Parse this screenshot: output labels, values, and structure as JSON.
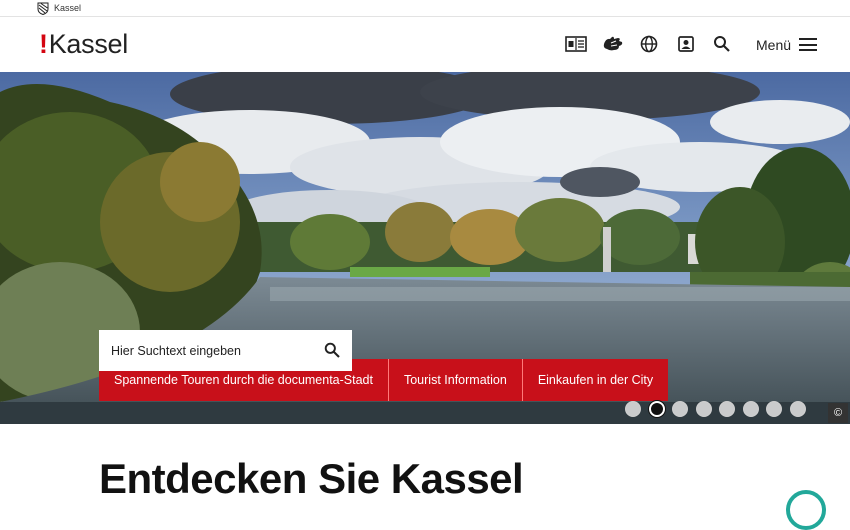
{
  "topbar": {
    "label": "Kassel"
  },
  "header": {
    "logo_text": "Kassel",
    "logo_mark": "!",
    "icons": [
      "easy-language-icon",
      "sign-language-icon",
      "globe-icon",
      "contact-icon",
      "search-icon"
    ],
    "menu_label": "Menü"
  },
  "hero": {
    "pills": [
      {
        "label": "Spannende Touren durch die documenta-Stadt"
      },
      {
        "label": "Tourist Information"
      },
      {
        "label": "Einkaufen in der City"
      }
    ],
    "search": {
      "placeholder": "Hier Suchtext eingeben"
    },
    "carousel": {
      "count": 8,
      "active_index": 1
    },
    "copyright_symbol": "©"
  },
  "main": {
    "headline": "Entdecken Sie Kassel"
  },
  "colors": {
    "brand_red": "#c8101a",
    "accent_teal": "#22a89a",
    "text": "#1a1a1a"
  }
}
